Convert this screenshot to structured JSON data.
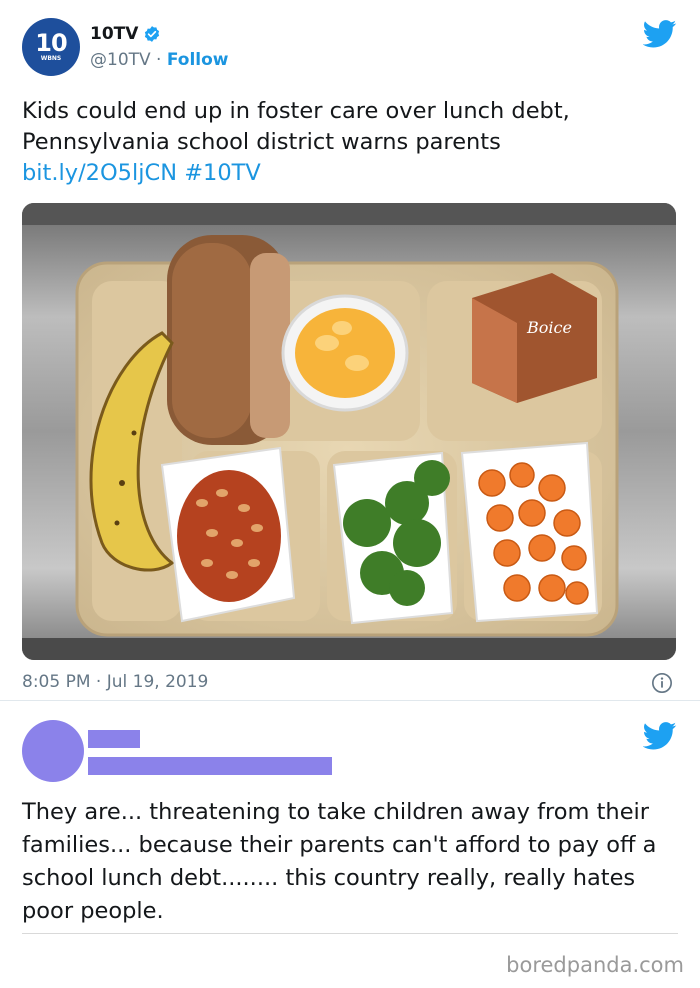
{
  "tweet": {
    "display_name": "10TV",
    "handle": "@10TV",
    "separator": " · ",
    "follow_label": "Follow",
    "avatar_logo": "10",
    "avatar_sub": "WBNS",
    "text_line1": "Kids could end up in foster care over lunch debt,",
    "text_line2": "Pennsylvania school district warns parents",
    "link": "bit.ly/2O5ljCN",
    "hashtag": "#10TV",
    "timestamp": "8:05 PM · Jul 19, 2019",
    "milk_brand": "Boice",
    "icons": {
      "verified": "verified-badge-icon",
      "platform": "twitter-bird-icon",
      "info": "info-icon"
    }
  },
  "reply": {
    "text": "They are... threatening to take children away from their families... because their parents can't afford to pay off a school lunch debt........ this country really, really hates poor people."
  },
  "watermark": "boredpanda.com",
  "colors": {
    "brand_blue": "#1da1f2",
    "link_blue": "#1b95e0",
    "avatar_blue": "#1e4f9c",
    "redaction_purple": "#8b82ea"
  }
}
